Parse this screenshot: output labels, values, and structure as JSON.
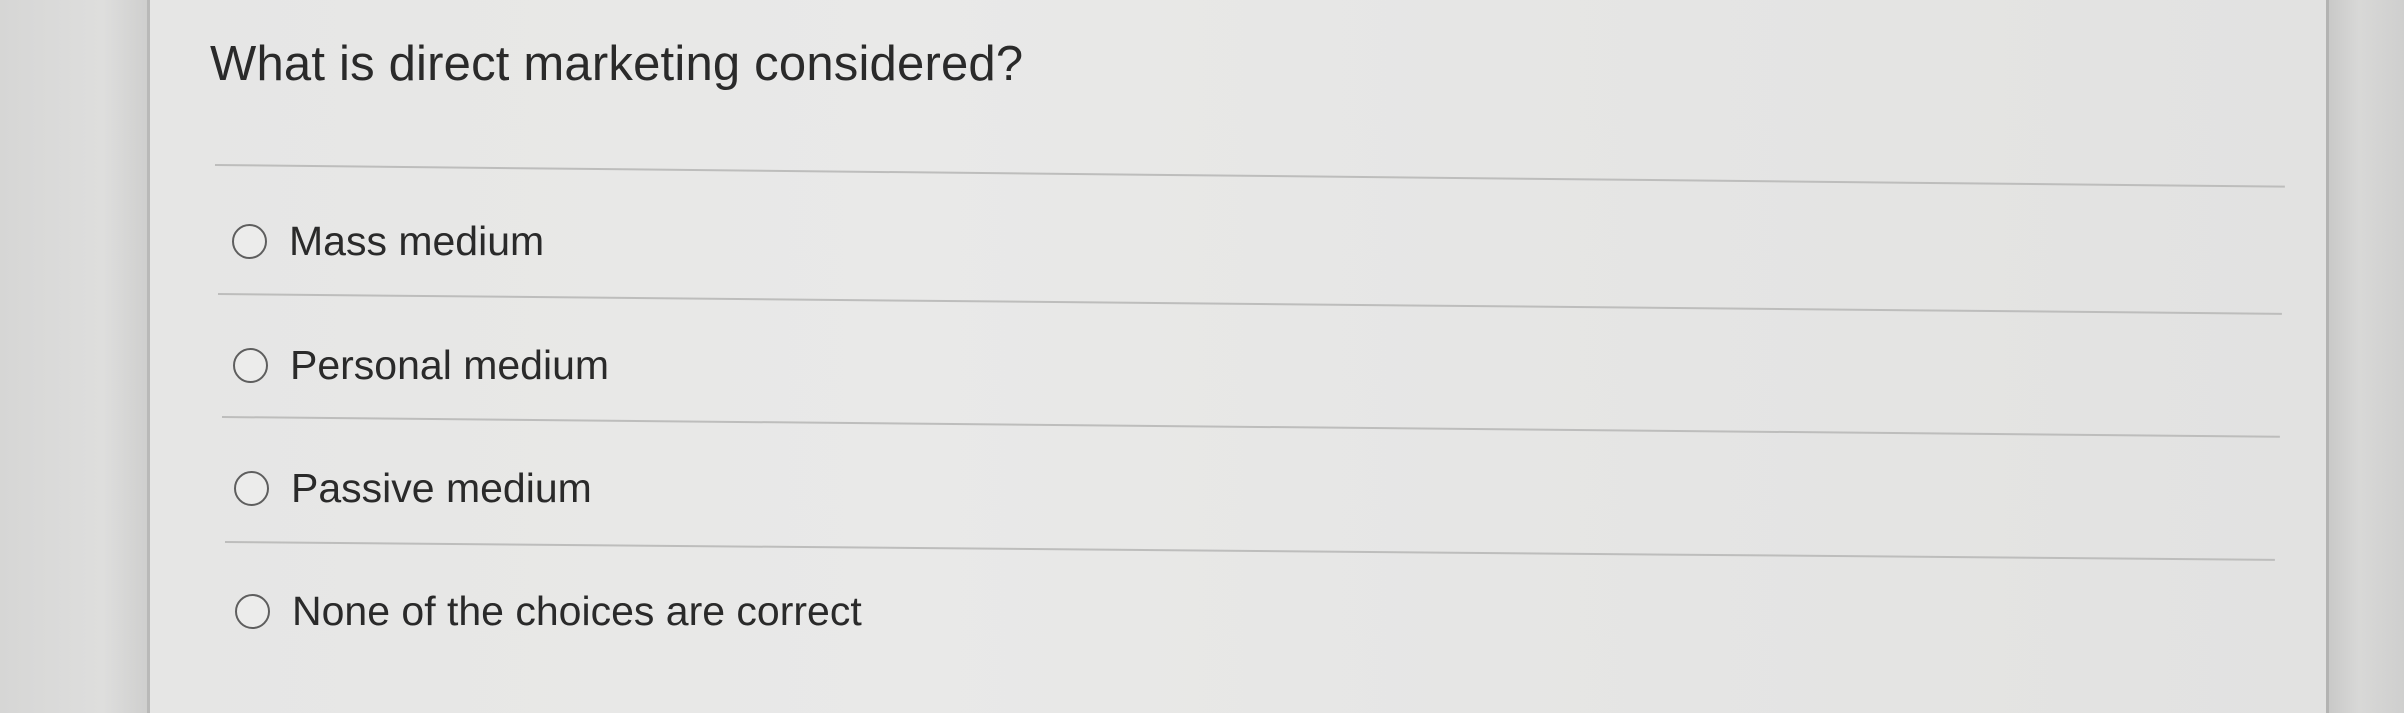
{
  "question": {
    "text": "What is direct marketing considered?"
  },
  "options": [
    {
      "label": "Mass medium",
      "selected": false
    },
    {
      "label": "Personal medium",
      "selected": false
    },
    {
      "label": "Passive medium",
      "selected": false
    },
    {
      "label": "None of the choices are correct",
      "selected": false
    }
  ]
}
